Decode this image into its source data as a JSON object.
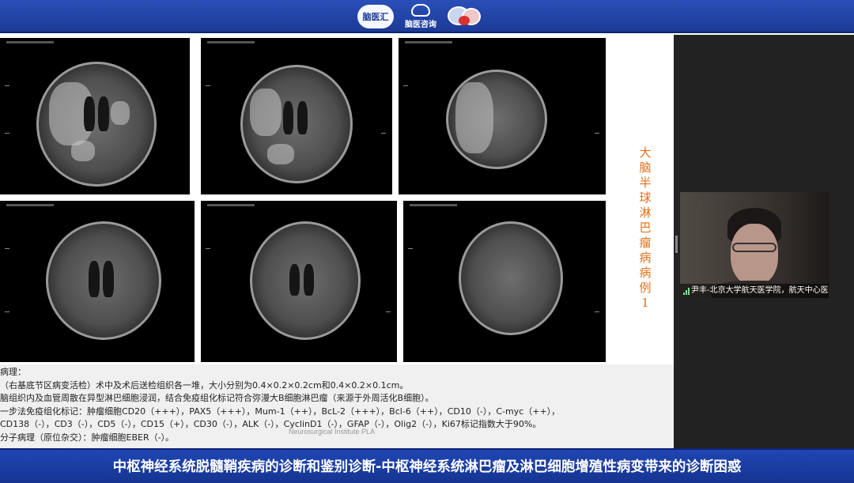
{
  "header": {
    "logos": [
      {
        "name": "naoyihui-logo",
        "text": "脑医汇"
      },
      {
        "name": "naoyizixun-logo",
        "text": "脑医咨询"
      },
      {
        "name": "brain-logo",
        "text": ""
      }
    ]
  },
  "slide": {
    "title": "大脑半球淋巴瘤病 病例1",
    "report_lines": [
      "病理：",
      "      （右基底节区病变活检）术中及术后送检组织各一堆，大小分别为0.4×0.2×0.2cm和0.4×0.2×0.1cm。",
      "   脑组织内及血管周散在异型淋巴细胞浸润，结合免疫组化标记符合弥漫大B细胞淋巴瘤（来源于外周活化B细胞）。",
      "   一步法免疫组化标记：肿瘤细胞CD20（+++），PAX5（+++），Mum-1（++），BcL-2（+++），Bcl-6（++），CD10（-），C-myc（++），",
      "CD138（-），CD3（-），CD5（-），CD15（+），CD30（-），ALK（-），CyclinD1（-），GFAP（-），Olig2（-），Ki67标记指数大于90%。",
      "   分子病理（原位杂交）：肿瘤细胞EBER（-）。"
    ],
    "watermark": "Neurosurgical Institute PLA"
  },
  "video": {
    "participant_label": "尹丰-北京大学航天医学院，航天中心医院"
  },
  "caption": {
    "text": "中枢神经系统脱髓鞘疾病的诊断和鉴别诊断-中枢神经系统淋巴瘤及淋巴细胞增殖性病变带来的诊断困惑"
  },
  "colors": {
    "top_bar": "#1c3a97",
    "caption_bar": "#163491",
    "slide_title": "#e0701e"
  }
}
